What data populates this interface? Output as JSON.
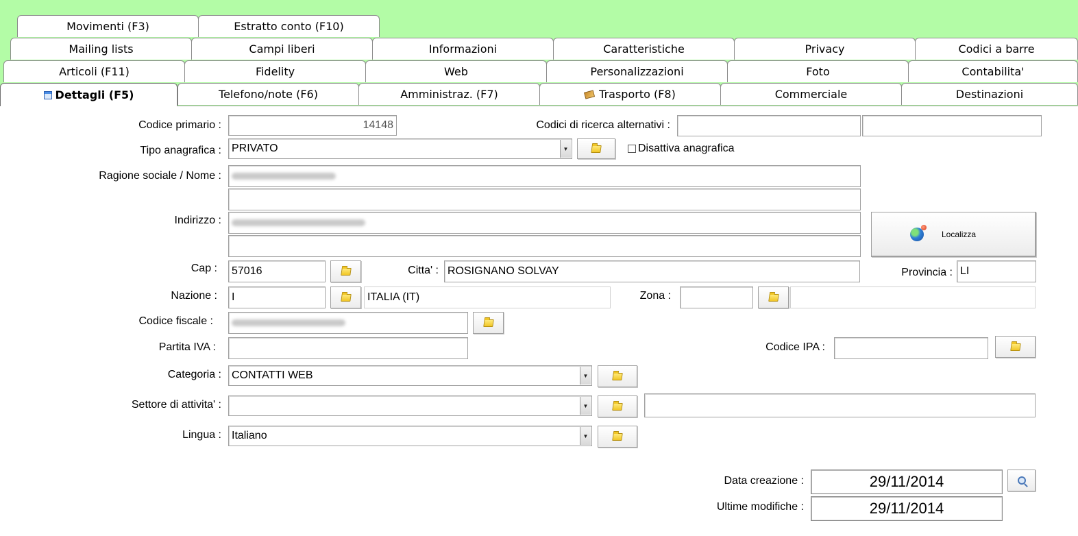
{
  "tabs": {
    "row1": [
      "Movimenti (F3)",
      "Estratto conto (F10)"
    ],
    "row2": [
      "Mailing lists",
      "Campi liberi",
      "Informazioni",
      "Caratteristiche",
      "Privacy",
      "Codici a barre"
    ],
    "row3": [
      "Articoli (F11)",
      "Fidelity",
      "Web",
      "Personalizzazioni",
      "Foto",
      "Contabilita'"
    ],
    "row4": [
      "Dettagli (F5)",
      "Telefono/note (F6)",
      "Amministraz. (F7)",
      "Trasporto (F8)",
      "Commerciale",
      "Destinazioni"
    ],
    "active": "Dettagli (F5)"
  },
  "form": {
    "codice_primario": {
      "label": "Codice primario :",
      "value": "14148"
    },
    "codici_ricerca": {
      "label": "Codici di ricerca alternativi :",
      "value1": "",
      "value2": ""
    },
    "tipo_anagrafica": {
      "label": "Tipo anagrafica :",
      "value": "PRIVATO"
    },
    "disattiva": {
      "label": "Disattiva anagrafica",
      "checked": false
    },
    "ragione_sociale": {
      "label": "Ragione sociale / Nome :",
      "value": "",
      "value2": ""
    },
    "indirizzo": {
      "label": "Indirizzo :",
      "value": "",
      "value2": ""
    },
    "localizza": {
      "label": "Localizza"
    },
    "cap": {
      "label": "Cap :",
      "value": "57016"
    },
    "citta": {
      "label": "Citta' :",
      "value": "ROSIGNANO SOLVAY"
    },
    "provincia": {
      "label": "Provincia :",
      "value": "LI"
    },
    "nazione": {
      "label": "Nazione :",
      "value": "I",
      "description": "ITALIA (IT)"
    },
    "zona": {
      "label": "Zona :",
      "value": "",
      "description": ""
    },
    "codice_fiscale": {
      "label": "Codice fiscale :",
      "value": ""
    },
    "partita_iva": {
      "label": "Partita IVA :",
      "value": ""
    },
    "codice_ipa": {
      "label": "Codice IPA :",
      "value": ""
    },
    "categoria": {
      "label": "Categoria :",
      "value": "CONTATTI WEB"
    },
    "settore": {
      "label": "Settore di attivita' :",
      "value": "",
      "description": ""
    },
    "lingua": {
      "label": "Lingua :",
      "value": "Italiano"
    },
    "data_creazione": {
      "label": "Data creazione :",
      "value": "29/11/2014"
    },
    "ultime_modifiche": {
      "label": "Ultime modifiche :",
      "value": "29/11/2014"
    }
  },
  "colors": {
    "tab_background": "#b3fca6",
    "window": "#ffffff"
  },
  "icons": [
    "window-icon",
    "truck-icon",
    "folder-icon",
    "globe-icon",
    "magnifier-icon",
    "dropdown-arrow-icon"
  ]
}
